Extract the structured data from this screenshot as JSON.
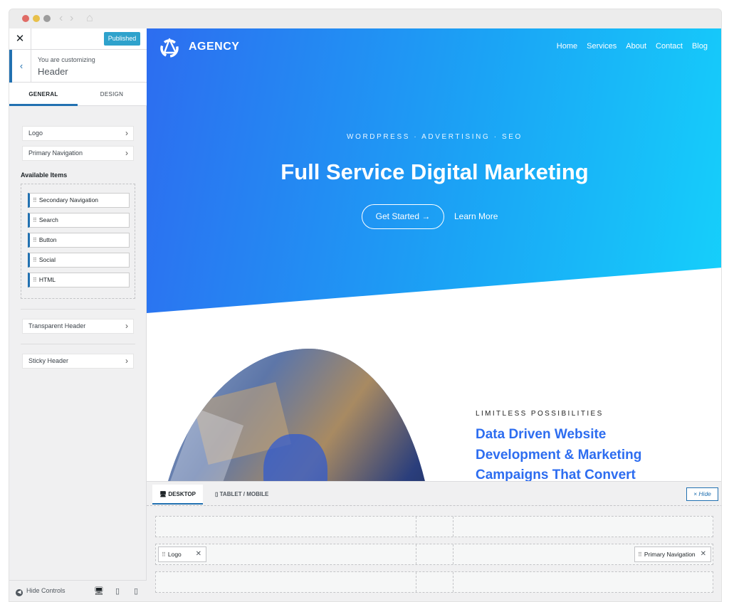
{
  "sidebar": {
    "close_label": "✕",
    "publish_label": "Published",
    "context_small": "You are customizing",
    "context_title": "Header",
    "back_label": "‹",
    "tabs": [
      {
        "label": "GENERAL"
      },
      {
        "label": "DESIGN"
      }
    ],
    "rows": [
      {
        "label": "Logo"
      },
      {
        "label": "Primary Navigation"
      }
    ],
    "available_title": "Available Items",
    "available_items": [
      {
        "label": "Secondary Navigation"
      },
      {
        "label": "Search"
      },
      {
        "label": "Button"
      },
      {
        "label": "Social"
      },
      {
        "label": "HTML"
      }
    ],
    "extra_rows": [
      {
        "label": "Transparent Header"
      },
      {
        "label": "Sticky Header"
      }
    ],
    "hide_controls_label": "Hide Controls"
  },
  "preview": {
    "brand": "AGENCY",
    "nav": [
      "Home",
      "Services",
      "About",
      "Contact",
      "Blog"
    ],
    "eyebrow": "WORDPRESS · ADVERTISING · SEO",
    "headline": "Full Service Digital Marketing",
    "cta_primary": "Get Started →",
    "cta_secondary": "Learn More",
    "limitless": "LIMITLESS POSSIBILITIES",
    "feature_lines": [
      "Data Driven Website",
      "Development & Marketing",
      "Campaigns That Convert"
    ],
    "colors": {
      "brand_blue": "#2d6df0",
      "hero_cyan": "#15d0fb",
      "wp_blue": "#2271b1"
    }
  },
  "builder": {
    "tabs": [
      {
        "label": "DESKTOP"
      },
      {
        "label": "TABLET / MOBILE"
      }
    ],
    "hide_label": "× Hide",
    "chip_logo": "Logo",
    "chip_nav": "Primary Navigation",
    "remove_icon": "✕"
  }
}
